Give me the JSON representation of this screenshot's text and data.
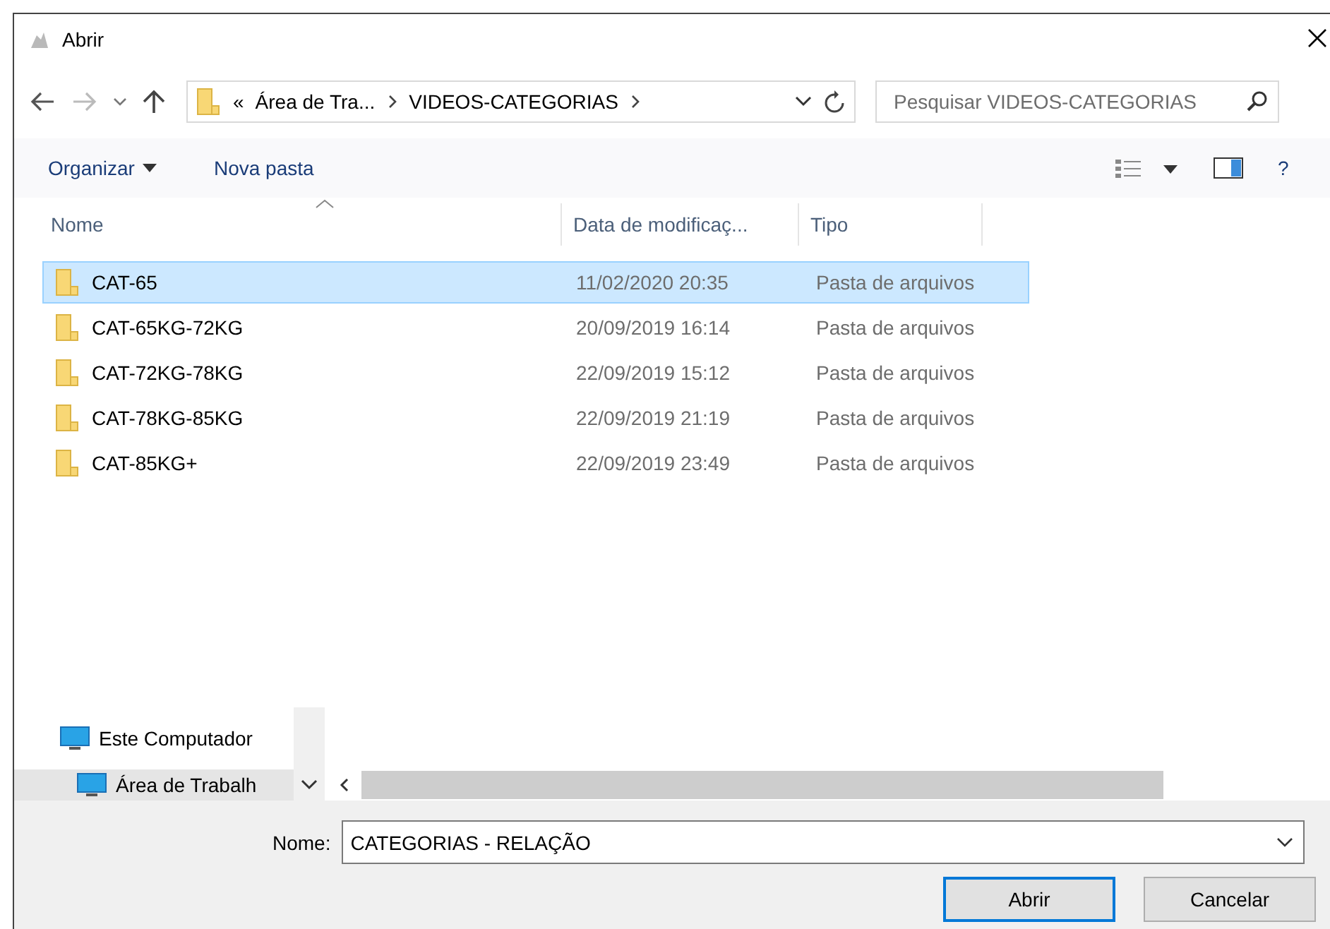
{
  "window": {
    "title": "Abrir"
  },
  "address_bar": {
    "overflow_mark": "«",
    "crumbs": [
      "Área de Tra...",
      "VIDEOS-CATEGORIAS"
    ]
  },
  "search": {
    "placeholder": "Pesquisar VIDEOS-CATEGORIAS"
  },
  "toolbar": {
    "organize": "Organizar",
    "new_folder": "Nova pasta",
    "help": "?"
  },
  "table": {
    "columns": [
      "Nome",
      "Data de modificaç...",
      "Tipo"
    ],
    "rows": [
      {
        "name": "CAT-65",
        "date": "11/02/2020 20:35",
        "type": "Pasta de arquivos",
        "selected": true
      },
      {
        "name": "CAT-65KG-72KG",
        "date": "20/09/2019 16:14",
        "type": "Pasta de arquivos",
        "selected": false
      },
      {
        "name": "CAT-72KG-78KG",
        "date": "22/09/2019 15:12",
        "type": "Pasta de arquivos",
        "selected": false
      },
      {
        "name": "CAT-78KG-85KG",
        "date": "22/09/2019 21:19",
        "type": "Pasta de arquivos",
        "selected": false
      },
      {
        "name": "CAT-85KG+",
        "date": "22/09/2019 23:49",
        "type": "Pasta de arquivos",
        "selected": false
      }
    ]
  },
  "nav_pane": {
    "items": [
      {
        "label": "Este Computador",
        "selected": false
      },
      {
        "label": "Área de Trabalh",
        "selected": true
      }
    ]
  },
  "filename": {
    "label": "Nome:",
    "value": "CATEGORIAS - RELAÇÃO"
  },
  "buttons": [
    {
      "label": "Abrir",
      "default": true
    },
    {
      "label": "Cancelar",
      "default": false
    }
  ]
}
